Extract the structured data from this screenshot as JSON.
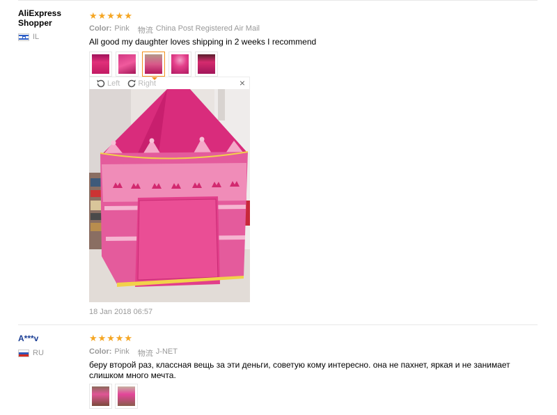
{
  "reviews": [
    {
      "user": "AliExpress Shopper",
      "country": "IL",
      "rating": 5,
      "color_label": "Color:",
      "color_value": "Pink",
      "shipping_label": "物流",
      "shipping_value": "China Post Registered Air Mail",
      "comment": "All good my daughter loves shipping in 2 weeks I recommend",
      "thumbnail_count": 5,
      "active_thumbnail": 3,
      "viewer": {
        "rotate_left": "Left",
        "rotate_right": "Right",
        "close": "×"
      },
      "date": "18 Jan 2018 06:57"
    },
    {
      "user": "A***v",
      "country": "RU",
      "rating": 5,
      "color_label": "Color:",
      "color_value": "Pink",
      "shipping_label": "物流",
      "shipping_value": "J-NET",
      "comment": "беру второй раз, классная вещь за эти деньги, советую кому интересно. она не пахнет, яркая и не занимает слишком много мечта.",
      "thumbnail_count": 2
    }
  ],
  "colors": {
    "star": "#f5a623",
    "accent": "#f38f1b",
    "tent_pink": "#e6408e",
    "name_blue": "#1c3f95"
  }
}
